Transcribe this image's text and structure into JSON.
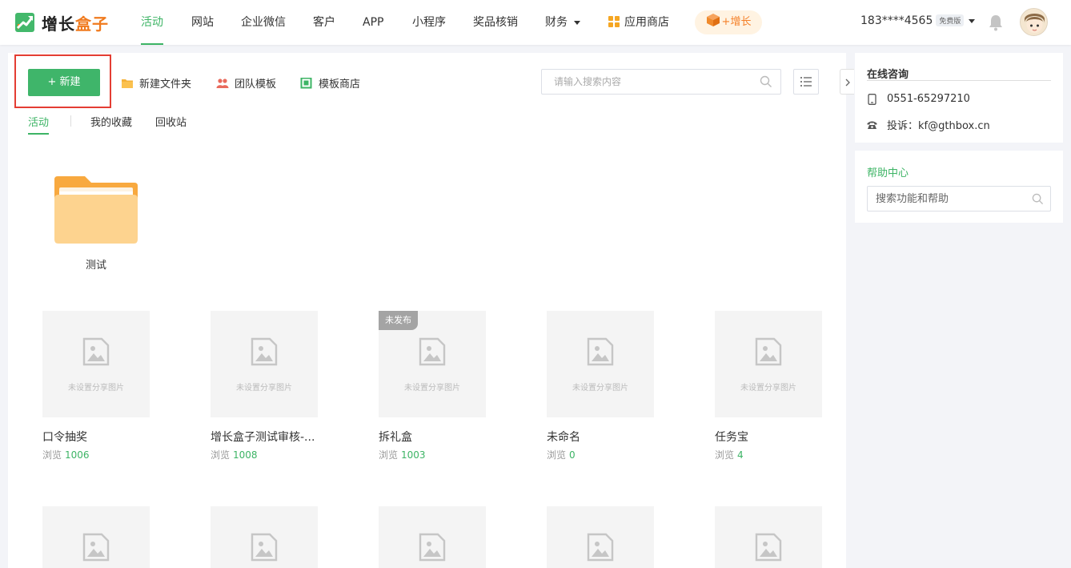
{
  "brand": {
    "name_part1": "增长",
    "name_part2": "盒子",
    "green": "#3db465",
    "orange": "#f07a1e"
  },
  "nav": {
    "items": [
      {
        "label": "活动",
        "active": true
      },
      {
        "label": "网站"
      },
      {
        "label": "企业微信"
      },
      {
        "label": "客户"
      },
      {
        "label": "APP"
      },
      {
        "label": "小程序"
      },
      {
        "label": "奖品核销"
      },
      {
        "label": "财务"
      },
      {
        "label": "应用商店"
      }
    ],
    "grow_label": "+增长",
    "user_phone": "183****4565",
    "plan_badge": "免费版"
  },
  "toolbar": {
    "new_label": "+ 新建",
    "new_folder_label": "新建文件夹",
    "team_template_label": "团队模板",
    "template_store_label": "模板商店",
    "search_placeholder": "请输入搜索内容"
  },
  "subtabs": [
    {
      "label": "活动",
      "active": true
    },
    {
      "label": "我的收藏"
    },
    {
      "label": "回收站"
    }
  ],
  "folders": [
    {
      "name": "测试"
    }
  ],
  "thumb_placeholder": "未设置分享图片",
  "views_label": "浏览",
  "cards": [
    {
      "title": "口令抽奖",
      "views": "1006",
      "badge": ""
    },
    {
      "title": "增长盒子测试审核-...",
      "views": "1008",
      "badge": ""
    },
    {
      "title": "拆礼盒",
      "views": "1003",
      "badge": "未发布"
    },
    {
      "title": "未命名",
      "views": "0",
      "badge": ""
    },
    {
      "title": "任务宝",
      "views": "4",
      "badge": ""
    }
  ],
  "consult": {
    "title": "在线咨询",
    "phone": "0551-65297210",
    "complaint": "投诉：kf@gthbox.cn"
  },
  "help": {
    "title": "帮助中心",
    "search_placeholder": "搜索功能和帮助"
  },
  "icons": {
    "logo": "logo-icon",
    "bell": "bell-icon",
    "search": "search-icon",
    "folder": "folder-icon",
    "team": "team-icon",
    "store": "store-icon",
    "list": "list-view-icon",
    "image": "image-placeholder-icon",
    "phone": "phone-icon",
    "telephone": "telephone-icon",
    "apps": "apps-icon",
    "box": "box-icon"
  }
}
